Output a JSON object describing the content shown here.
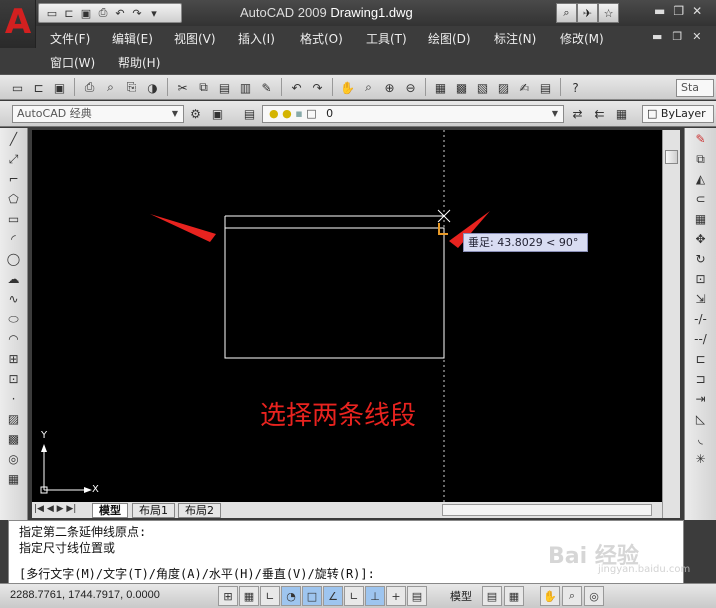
{
  "window": {
    "app_name": "AutoCAD 2009",
    "doc_name": "Drawing1.dwg"
  },
  "menus": [
    {
      "label": "文件(F)"
    },
    {
      "label": "编辑(E)"
    },
    {
      "label": "视图(V)"
    },
    {
      "label": "插入(I)"
    },
    {
      "label": "格式(O)"
    },
    {
      "label": "工具(T)"
    },
    {
      "label": "绘图(D)"
    },
    {
      "label": "标注(N)"
    },
    {
      "label": "修改(M)"
    },
    {
      "label": "窗口(W)"
    },
    {
      "label": "帮助(H)"
    }
  ],
  "toolbar": {
    "workspace": "AutoCAD 经典",
    "layer": "0",
    "linetype": "ByLayer",
    "style_box": "Sta"
  },
  "canvas": {
    "tooltip": "垂足: 43.8029 < 90°",
    "annotation": "选择两条线段",
    "ucs_x": "X",
    "ucs_y": "Y"
  },
  "tabs": [
    {
      "label": "模型"
    },
    {
      "label": "布局1"
    },
    {
      "label": "布局2"
    }
  ],
  "command": {
    "line1": "指定第二条延伸线原点:",
    "line2": "指定尺寸线位置或",
    "line3": "[多行文字(M)/文字(T)/角度(A)/水平(H)/垂直(V)/旋转(R)]:"
  },
  "status": {
    "coordinates": "2288.7761, 1744.7917, 0.0000",
    "model_label": "模型"
  },
  "watermark": {
    "main": "Bai 经验",
    "sub": "jingyan.baidu.com"
  },
  "colors": {
    "accent_red": "#e8231f",
    "canvas": "#000000",
    "tooltip_bg": "#d8dcf2"
  }
}
